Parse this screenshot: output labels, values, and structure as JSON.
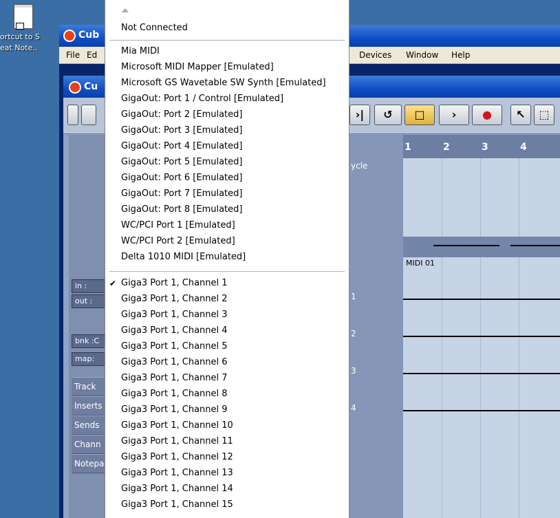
{
  "desktop": {
    "icon_caption_line1": "ortcut to S",
    "icon_caption_line2": "eat Note.."
  },
  "outer_window": {
    "title": "Cub",
    "menu": {
      "file": "File",
      "edit": "Ed",
      "devices": "Devices",
      "window": "Window",
      "help": "Help"
    }
  },
  "inner_window": {
    "title": "Cu",
    "inspector": {
      "in_label": "in :",
      "out_label": "out :",
      "bnk_label": "bnk :C",
      "map_label": "map:",
      "tabs": [
        "Track",
        "Inserts",
        "Sends",
        "Chann",
        "Notepa"
      ]
    },
    "tracklist": {
      "cycle_label": "ycle",
      "track_numbers": [
        "1",
        "2",
        "3",
        "4"
      ]
    },
    "arrange": {
      "ruler": [
        "1",
        "2",
        "3",
        "4"
      ],
      "part_name": "MIDI 01"
    }
  },
  "dropdown": {
    "not_connected": "Not Connected",
    "devices": [
      "Mia MIDI",
      "Microsoft MIDI Mapper [Emulated]",
      "Microsoft GS Wavetable SW Synth [Emulated]",
      "GigaOut: Port 1 / Control [Emulated]",
      "GigaOut: Port 2 [Emulated]",
      "GigaOut: Port 3 [Emulated]",
      "GigaOut: Port 4 [Emulated]",
      "GigaOut: Port 5 [Emulated]",
      "GigaOut: Port 6 [Emulated]",
      "GigaOut: Port 7 [Emulated]",
      "GigaOut: Port 8 [Emulated]",
      "WC/PCI Port 1 [Emulated]",
      "WC/PCI Port 2 [Emulated]",
      "Delta 1010 MIDI [Emulated]"
    ],
    "channels": [
      "Giga3 Port 1, Channel 1",
      "Giga3 Port 1, Channel 2",
      "Giga3 Port 1, Channel 3",
      "Giga3 Port 1, Channel 4",
      "Giga3 Port 1, Channel 5",
      "Giga3 Port 1, Channel 6",
      "Giga3 Port 1, Channel 7",
      "Giga3 Port 1, Channel 8",
      "Giga3 Port 1, Channel 9",
      "Giga3 Port 1, Channel 10",
      "Giga3 Port 1, Channel 11",
      "Giga3 Port 1, Channel 12",
      "Giga3 Port 1, Channel 13",
      "Giga3 Port 1, Channel 14",
      "Giga3 Port 1, Channel 15"
    ],
    "checked_channel": "Giga3 Port 1, Channel 1",
    "check_glyph": "✔"
  },
  "icons": [
    "notepad-shortcut-icon",
    "cubase-logo-icon",
    "dropdown-scroll-up-icon",
    "checkmark-icon"
  ]
}
